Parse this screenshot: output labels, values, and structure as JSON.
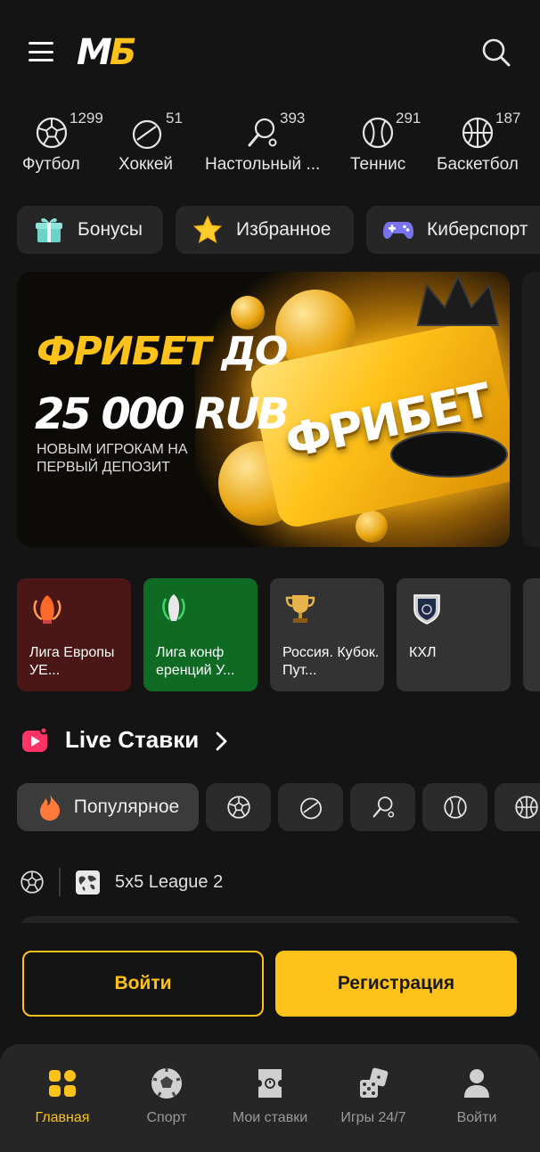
{
  "header": {
    "logo_m": "M",
    "logo_g": "Б"
  },
  "sports": [
    {
      "icon": "soccer-ball-icon",
      "count": "1299",
      "label": "Футбол"
    },
    {
      "icon": "hockey-puck-icon",
      "count": "51",
      "label": "Хоккей"
    },
    {
      "icon": "table-tennis-icon",
      "count": "393",
      "label": "Настольный ..."
    },
    {
      "icon": "tennis-ball-icon",
      "count": "291",
      "label": "Теннис"
    },
    {
      "icon": "basketball-icon",
      "count": "187",
      "label": "Баскетбол"
    }
  ],
  "chips": [
    {
      "icon": "gift-icon",
      "label": "Бонусы"
    },
    {
      "icon": "star-icon",
      "label": "Избранное"
    },
    {
      "icon": "gamepad-icon",
      "label": "Киберспорт"
    }
  ],
  "banner": {
    "line1_a": "ФРИБЕТ",
    "line1_b": " ДО",
    "line2": "25 000 RUB",
    "line3": "НОВЫМ ИГРОКАМ НА ПЕРВЫЙ ДЕПОЗИТ",
    "plate_text": "ФРИБЕТ"
  },
  "leagues": [
    {
      "label": "Лига Европы УЕ...",
      "bg": "#4a1616"
    },
    {
      "label": "Лига конф еренций У...",
      "bg": "#0f6b24"
    },
    {
      "label": "Россия. Кубок. Пут...",
      "bg": "#333333"
    },
    {
      "label": "КХЛ",
      "bg": "#333333"
    }
  ],
  "live": {
    "title": "Live Ставки"
  },
  "filters": {
    "popular_label": "Популярное"
  },
  "match": {
    "league_name": "5x5 League 2"
  },
  "auth": {
    "login_label": "Войти",
    "register_label": "Регистрация"
  },
  "bottom_nav": [
    {
      "label": "Главная"
    },
    {
      "label": "Спорт"
    },
    {
      "label": "Мои ставки"
    },
    {
      "label": "Игры 24/7"
    },
    {
      "label": "Войти"
    }
  ],
  "colors": {
    "accent": "#ffc21a",
    "background": "#141414",
    "surface": "#262626"
  }
}
